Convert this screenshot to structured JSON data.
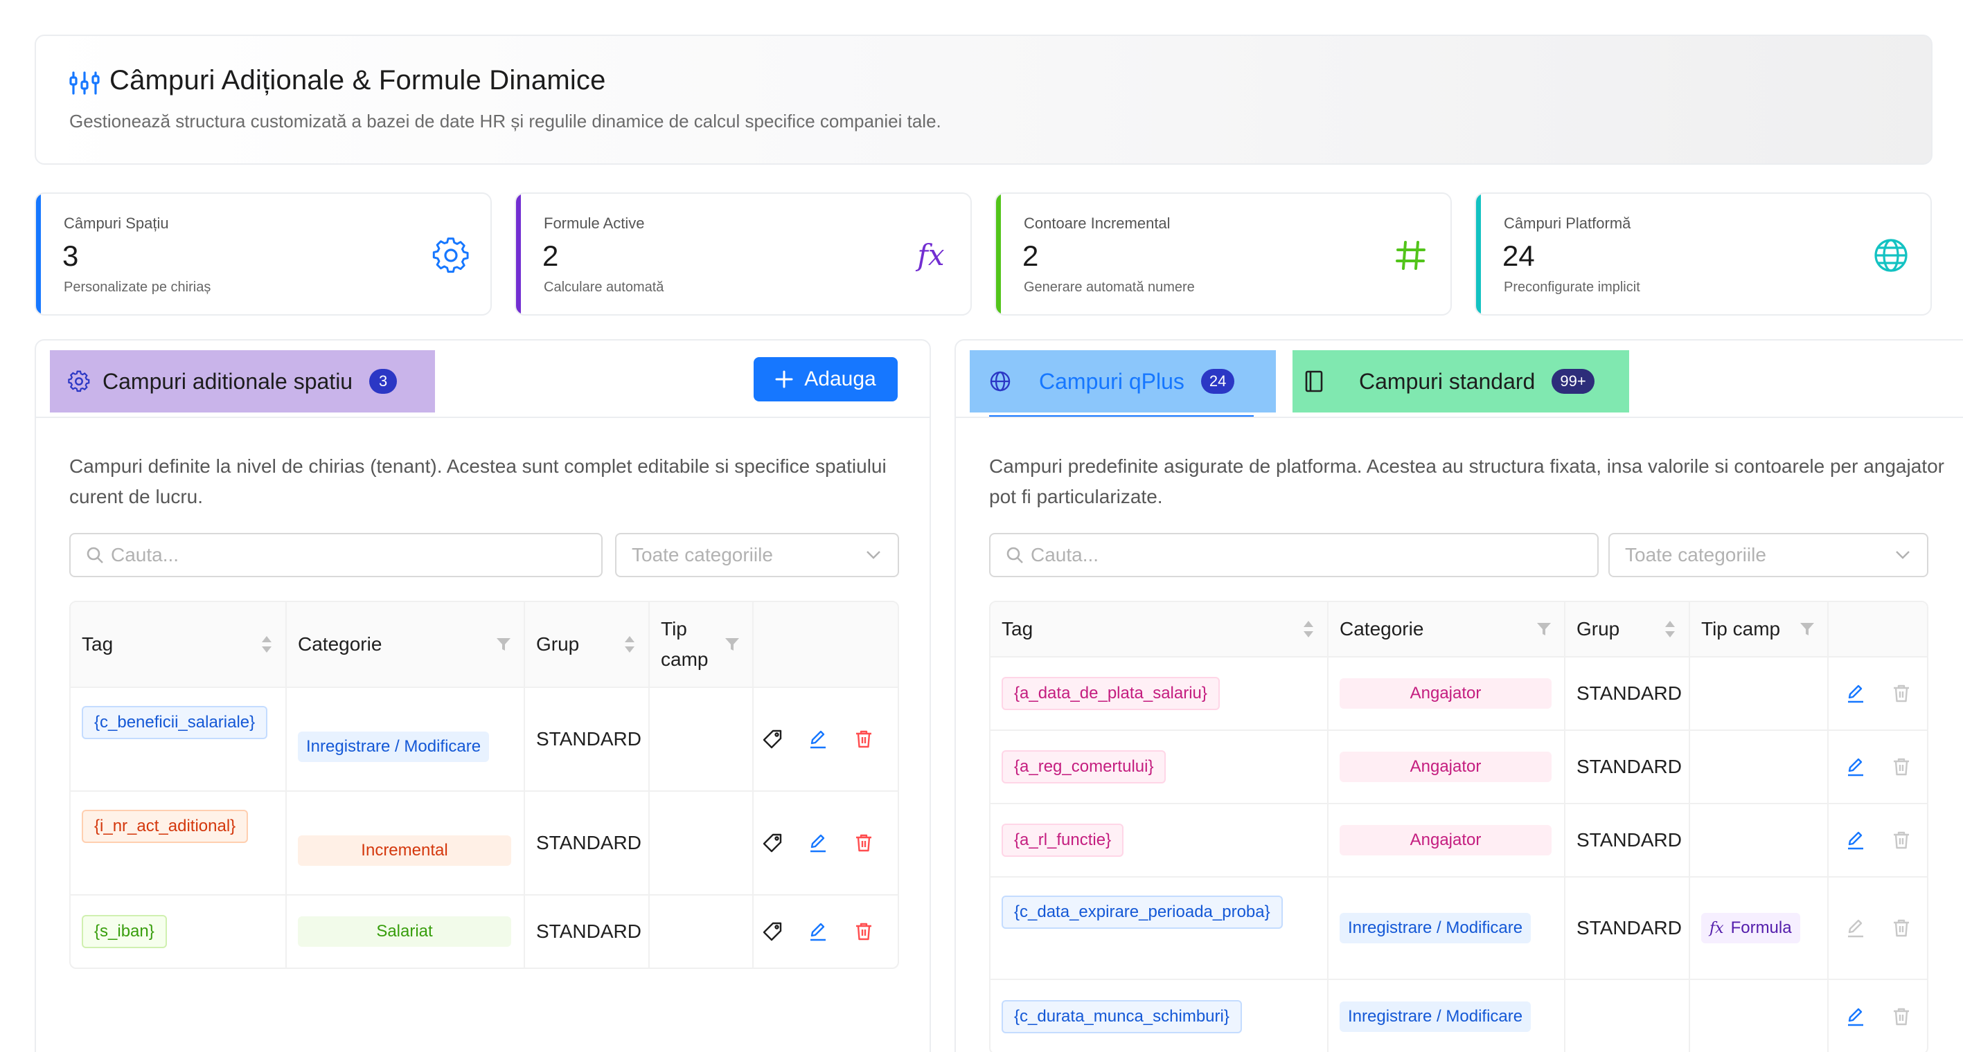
{
  "header": {
    "title": "Câmpuri Adiționale & Formule Dinamice",
    "subtitle": "Gestionează structura customizată a bazei de date HR și regulile dinamice de calcul specifice companiei tale."
  },
  "stats": [
    {
      "label": "Câmpuri Spațiu",
      "value": "3",
      "desc": "Personalizate pe chiriaș",
      "color": "#1677ff",
      "icon": "gear-icon"
    },
    {
      "label": "Formule Active",
      "value": "2",
      "desc": "Calculare automată",
      "color": "#722ed1",
      "icon": "function-icon"
    },
    {
      "label": "Contoare Incremental",
      "value": "2",
      "desc": "Generare automată numere",
      "color": "#52c41a",
      "icon": "hash-icon"
    },
    {
      "label": "Câmpuri Platformă",
      "value": "24",
      "desc": "Preconfigurate implicit",
      "color": "#13c2c2",
      "icon": "globe-icon"
    }
  ],
  "left": {
    "title": "Campuri aditionale spatiu",
    "count": "3",
    "add_label": "Adauga",
    "description": "Campuri definite la nivel de chirias (tenant). Acestea sunt complet editabile si specifice spatiului curent de lucru.",
    "search_placeholder": "Cauta...",
    "category_placeholder": "Toate categoriile",
    "columns": {
      "tag": "Tag",
      "categorie": "Categorie",
      "grup": "Grup",
      "tip_line1": "Tip",
      "tip_line2": "camp"
    },
    "rows": [
      {
        "tag": "{c_beneficii_salariale}",
        "categorie": "Inregistrare / Modificare",
        "grup": "STANDARD",
        "tip": ""
      },
      {
        "tag": "{i_nr_act_aditional}",
        "categorie": "Incremental",
        "grup": "STANDARD",
        "tip": ""
      },
      {
        "tag": "{s_iban}",
        "categorie": "Salariat",
        "grup": "STANDARD",
        "tip": ""
      }
    ]
  },
  "right": {
    "tab_qplus": "Campuri qPlus",
    "tab_qplus_count": "24",
    "tab_standard": "Campuri standard",
    "tab_standard_count": "99+",
    "description": "Campuri predefinite asigurate de platforma. Acestea au structura fixata, insa valorile si contoarele per angajator pot fi particularizate.",
    "search_placeholder": "Cauta...",
    "category_placeholder": "Toate categoriile",
    "columns": {
      "tag": "Tag",
      "categorie": "Categorie",
      "grup": "Grup",
      "tip": "Tip camp"
    },
    "rows": [
      {
        "tag": "{a_data_de_plata_salariu}",
        "categorie": "Angajator",
        "grup": "STANDARD",
        "tip": ""
      },
      {
        "tag": "{a_reg_comertului}",
        "categorie": "Angajator",
        "grup": "STANDARD",
        "tip": ""
      },
      {
        "tag": "{a_rl_functie}",
        "categorie": "Angajator",
        "grup": "STANDARD",
        "tip": ""
      },
      {
        "tag": "{c_data_expirare_perioada_proba}",
        "categorie": "Inregistrare / Modificare",
        "grup": "STANDARD",
        "tip": "Formula"
      },
      {
        "tag": "{c_durata_munca_schimburi}",
        "categorie": "Inregistrare / Modificare",
        "grup": "",
        "tip": ""
      }
    ]
  }
}
